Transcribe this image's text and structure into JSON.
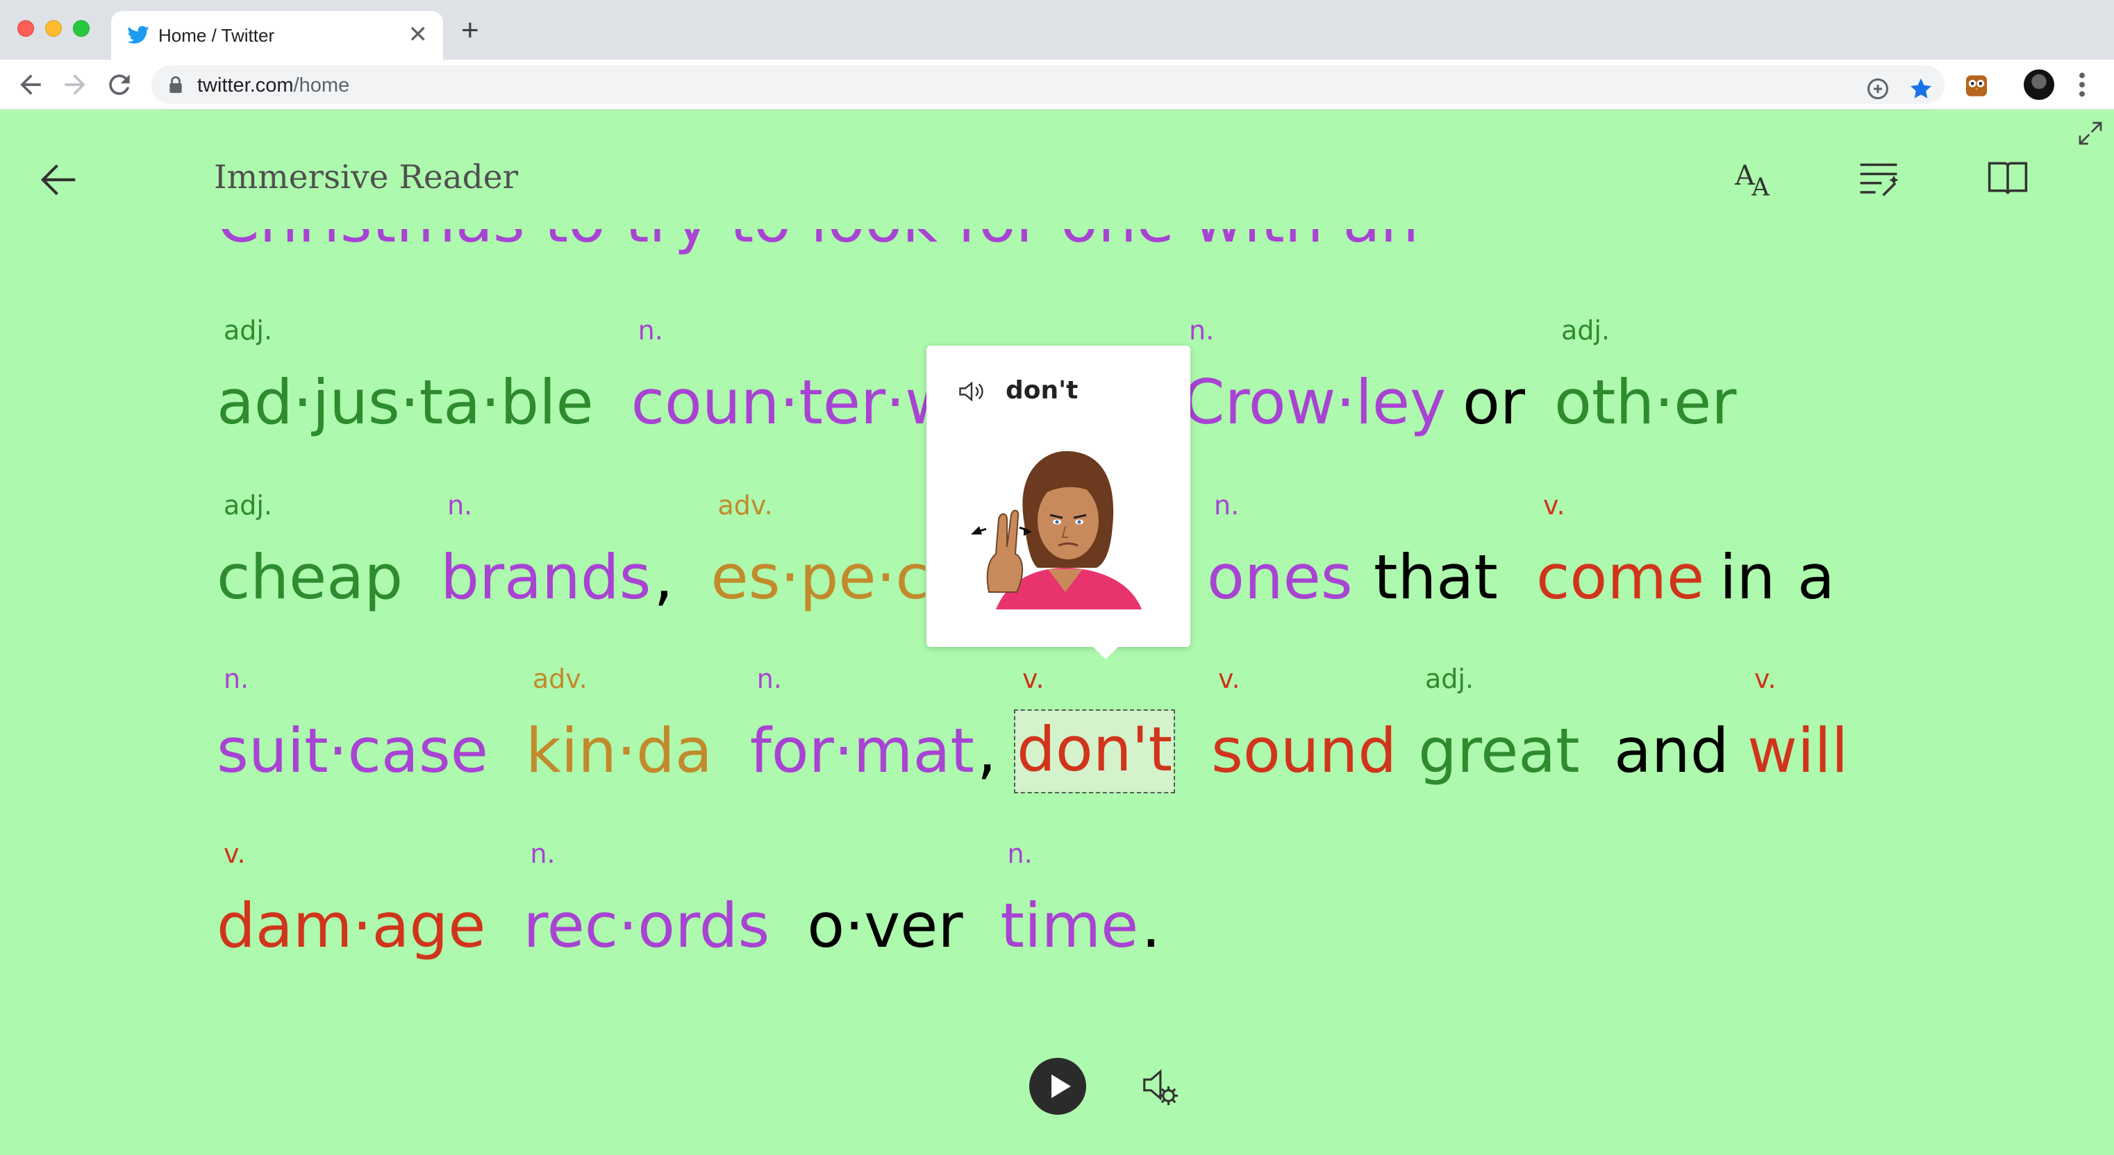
{
  "browser": {
    "tab_title": "Home / Twitter",
    "new_tab_label": "+",
    "close_tab_label": "✕",
    "url_host": "twitter.com",
    "url_path": "/home"
  },
  "reader": {
    "title": "Immersive Reader",
    "top_line_partial": "Christmas to try to look for one with an",
    "lines": [
      [
        {
          "text": "ad·jus·ta·ble",
          "pos": "adj.",
          "cls": "adj"
        },
        {
          "text": "coun·ter·w",
          "pos": "n.",
          "cls": "noun"
        },
        {
          "text": "Crow·ley",
          "pos": "n.",
          "cls": "noun"
        },
        {
          "text": "or",
          "pos": "",
          "cls": "plain"
        },
        {
          "text": "oth·er",
          "pos": "adj.",
          "cls": "adj"
        }
      ],
      [
        {
          "text": "cheap",
          "pos": "adj.",
          "cls": "adj"
        },
        {
          "text": "brands",
          "pos": "n.",
          "cls": "noun"
        },
        {
          "text": "es·pe·ci",
          "pos": "adv.",
          "cls": "adv"
        },
        {
          "text": "ones",
          "pos": "n.",
          "cls": "noun"
        },
        {
          "text": "that",
          "pos": "",
          "cls": "plain"
        },
        {
          "text": "come",
          "pos": "v.",
          "cls": "verb"
        },
        {
          "text": "in",
          "pos": "",
          "cls": "plain"
        },
        {
          "text": "a",
          "pos": "",
          "cls": "plain"
        }
      ],
      [
        {
          "text": "suit·case",
          "pos": "n.",
          "cls": "noun"
        },
        {
          "text": "kin·da",
          "pos": "adv.",
          "cls": "adv"
        },
        {
          "text": "for·mat",
          "pos": "n.",
          "cls": "noun"
        },
        {
          "text": "don't",
          "pos": "v.",
          "cls": "verb"
        },
        {
          "text": "sound",
          "pos": "v.",
          "cls": "verb"
        },
        {
          "text": "great",
          "pos": "adj.",
          "cls": "adj"
        },
        {
          "text": "and",
          "pos": "",
          "cls": "plain"
        },
        {
          "text": "will",
          "pos": "v.",
          "cls": "verb"
        }
      ],
      [
        {
          "text": "dam·age",
          "pos": "v.",
          "cls": "verb"
        },
        {
          "text": "rec·ords",
          "pos": "n.",
          "cls": "noun"
        },
        {
          "text": "o·ver",
          "pos": "",
          "cls": "plain"
        },
        {
          "text": "time",
          "pos": "n.",
          "cls": "noun"
        }
      ]
    ],
    "punctuation": {
      "comma": ",",
      "period": "."
    },
    "popup": {
      "word": "don't",
      "image": "sign-language-dont-icon"
    }
  },
  "colors": {
    "background": "#adf9ad",
    "noun": "#a843d3",
    "verb": "#d0351c",
    "adjective": "#2e8b2e",
    "adverb": "#c28a2c"
  }
}
